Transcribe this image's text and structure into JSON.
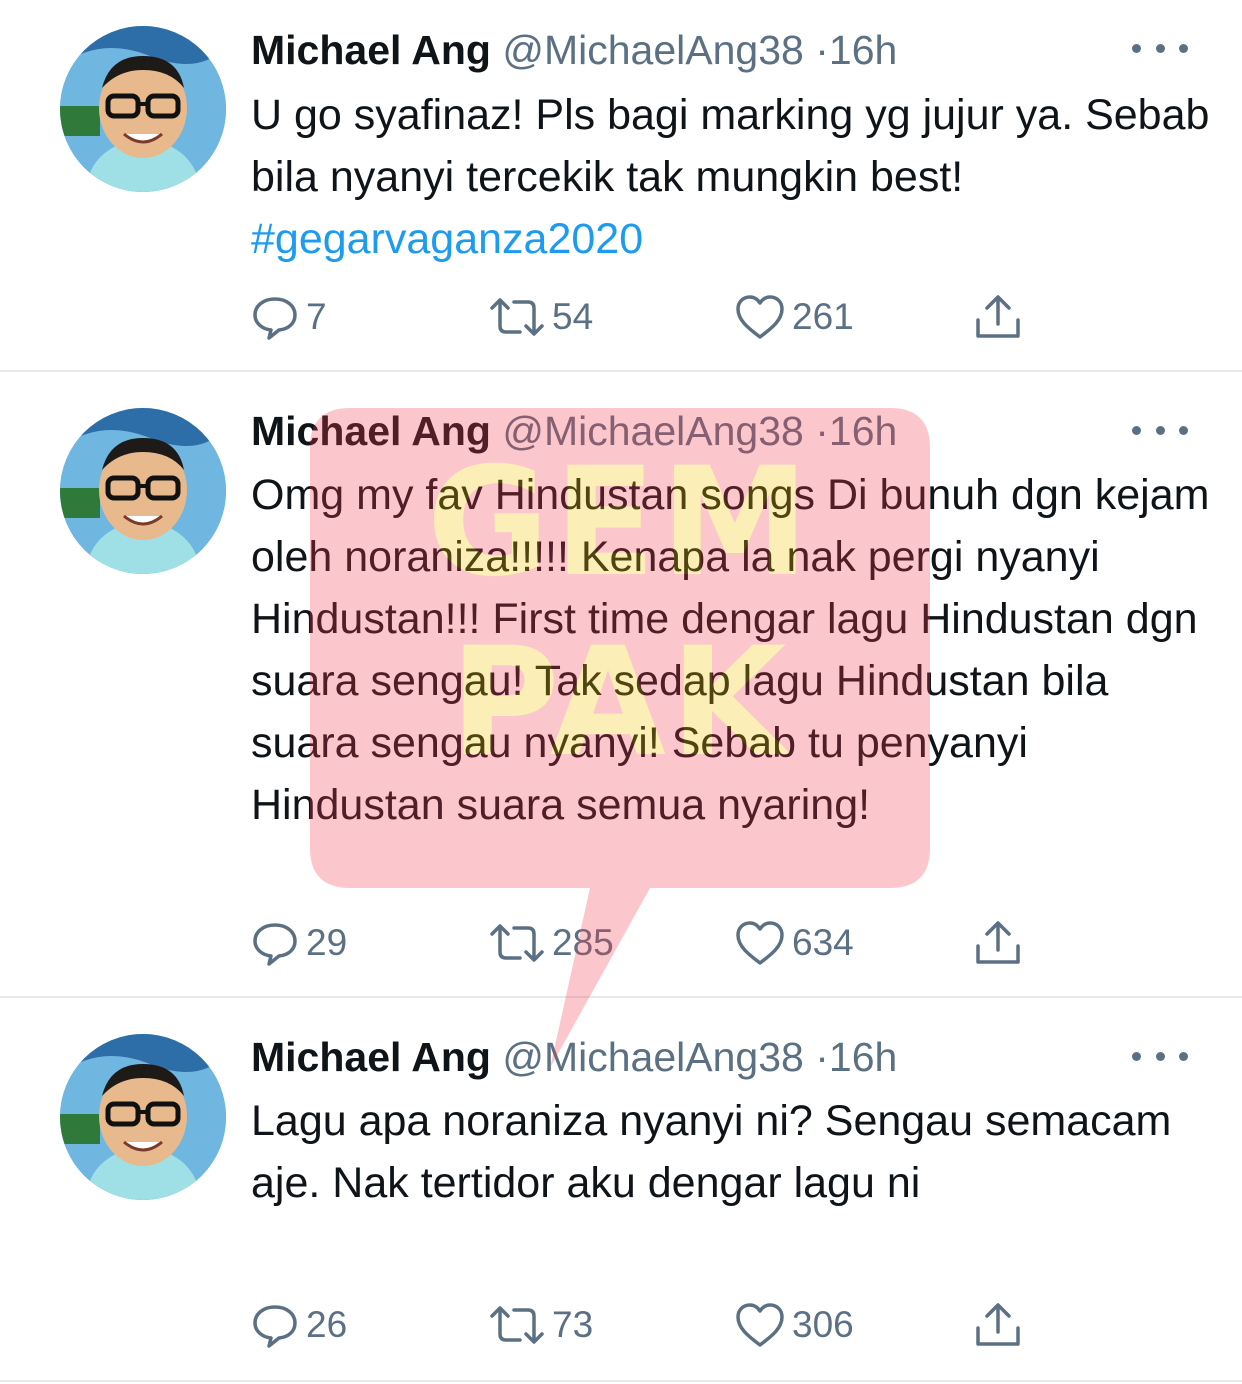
{
  "tweets": [
    {
      "name": "Michael Ang",
      "handle": "@MichaelAng38",
      "dot": "·",
      "time": "16h",
      "text": "U go syafinaz! Pls bagi marking yg jujur ya. Sebab bila nyanyi tercekik tak mungkin best! ",
      "hashtag": "#gegarvaganza2020",
      "replies": "7",
      "retweets": "54",
      "likes": "261"
    },
    {
      "name": "Michael Ang",
      "handle": "@MichaelAng38",
      "dot": "·",
      "time": "16h",
      "text": "Omg my fav Hindustan songs Di bunuh dgn kejam oleh noraniza!!!!! Kenapa la nak pergi nyanyi Hindustan!!! First time dengar lagu Hindustan dgn suara sengau! Tak sedap lagu Hindustan bila suara sengau nyanyi! Sebab tu penyanyi Hindustan suara semua nyaring!",
      "replies": "29",
      "retweets": "285",
      "likes": "634"
    },
    {
      "name": "Michael Ang",
      "handle": "@MichaelAng38",
      "dot": "·",
      "time": "16h",
      "text": "Lagu apa noraniza nyanyi ni? Sengau semacam aje. Nak tertidor aku dengar lagu ni",
      "replies": "26",
      "retweets": "73",
      "likes": "306"
    }
  ],
  "watermark": {
    "line1": "GEM",
    "line2": "PAK"
  },
  "icons": {
    "reply": "speech-bubble-icon",
    "retweet": "retweet-icon",
    "like": "heart-icon",
    "share": "share-icon",
    "more": "more-dots-icon"
  },
  "colors": {
    "text": "#0f1419",
    "secondary": "#5b7083",
    "hashtag": "#1d9bf0",
    "divider": "#e6e9ec",
    "watermark_red": "#f43a4a",
    "watermark_yellow": "#f5c300"
  }
}
